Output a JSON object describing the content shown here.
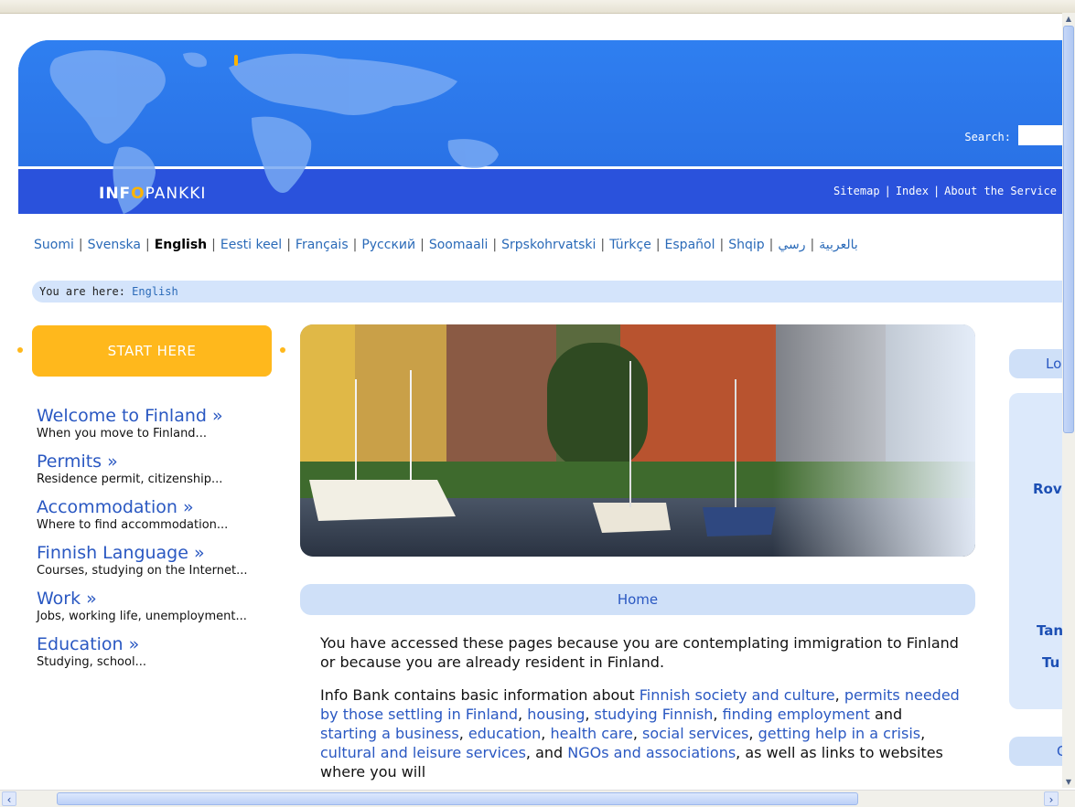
{
  "header": {
    "logo": {
      "part1": "INF",
      "part2": "O",
      "part3": "PANKKI"
    },
    "search_label": "Search:",
    "search_value": "",
    "links": [
      "Sitemap",
      "Index",
      "About the Service"
    ]
  },
  "languages": [
    "Suomi",
    "Svenska",
    "English",
    "Eesti keel",
    "Français",
    "Русский",
    "Soomaali",
    "Srpskohrvatski",
    "Türkçe",
    "Español",
    "Shqip",
    "بالعربية",
    "رسي"
  ],
  "current_language": "English",
  "breadcrumb": {
    "label": "You are here:",
    "current": "English"
  },
  "sidebar": {
    "start_label": "START HERE",
    "items": [
      {
        "title": "Welcome to Finland »",
        "desc": "When you move to Finland..."
      },
      {
        "title": "Permits »",
        "desc": "Residence permit, citizenship..."
      },
      {
        "title": "Accommodation »",
        "desc": "Where to find accommodation..."
      },
      {
        "title": "Finnish Language »",
        "desc": "Courses, studying on the Internet..."
      },
      {
        "title": "Work »",
        "desc": "Jobs, working life, unemployment..."
      },
      {
        "title": "Education »",
        "desc": "Studying, school..."
      }
    ]
  },
  "main": {
    "tab_label": "Home",
    "intro": "You have accessed these pages because you are contemplating immigration to Finland or because you are already resident in Finland.",
    "p2": {
      "prefix": "Info Bank contains basic information about",
      "link1": "Finnish society and culture",
      "link2": "permits needed by those settling in Finland",
      "link3": "housing",
      "link4": "studying Finnish",
      "link5": "finding employment",
      "and1": "and",
      "link6": "starting a business",
      "link7": "education",
      "link8": "health care",
      "link9": "social services",
      "link10": "getting help in a crisis",
      "link11": "cultural and leisure services",
      "cont": "and",
      "link12": "NGOs and associations",
      "tail": ", as well as links to websites where you will"
    }
  },
  "right": {
    "box1": "Lo",
    "cities": [
      "Rov",
      "Tan",
      "Tu"
    ],
    "box2": "C"
  }
}
